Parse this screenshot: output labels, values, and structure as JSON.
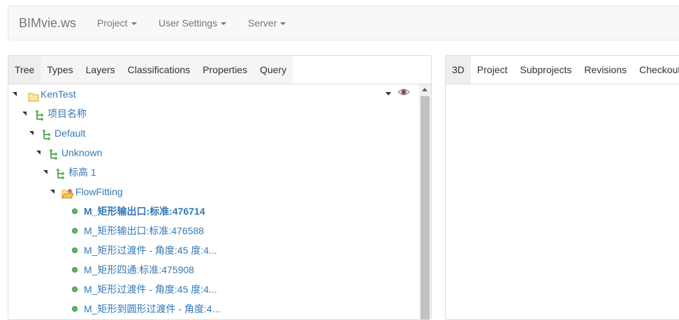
{
  "navbar": {
    "brand": "BIMvie.ws",
    "menus": [
      {
        "label": "Project"
      },
      {
        "label": "User Settings"
      },
      {
        "label": "Server"
      }
    ]
  },
  "left_panel": {
    "tabs": [
      {
        "label": "Tree",
        "active": true
      },
      {
        "label": "Types",
        "active": false
      },
      {
        "label": "Layers",
        "active": false
      },
      {
        "label": "Classifications",
        "active": false
      },
      {
        "label": "Properties",
        "active": false
      },
      {
        "label": "Query",
        "active": false
      }
    ],
    "tree": [
      {
        "label": "KenTest",
        "icon": "folder-icon",
        "level": 0
      },
      {
        "label": "项目名称",
        "icon": "hierarchy-icon",
        "level": 1
      },
      {
        "label": "Default",
        "icon": "hierarchy-icon",
        "level": 2
      },
      {
        "label": "Unknown",
        "icon": "hierarchy-icon",
        "level": 3
      },
      {
        "label": "标高 1",
        "icon": "hierarchy-icon",
        "level": 4
      },
      {
        "label": "FlowFitting",
        "icon": "folder-open-icon",
        "level": 5
      },
      {
        "label": "M_矩形输出口:标准:476714",
        "icon": "leaf-dot-icon",
        "level": 6,
        "bold": true
      },
      {
        "label": "M_矩形输出口:标准:476588",
        "icon": "leaf-dot-icon",
        "level": 6
      },
      {
        "label": "M_矩形过渡件 - 角度:45 度:4...",
        "icon": "leaf-dot-icon",
        "level": 6
      },
      {
        "label": "M_矩形四通:标准:475908",
        "icon": "leaf-dot-icon",
        "level": 6
      },
      {
        "label": "M_矩形过渡件 - 角度:45 度:4...",
        "icon": "leaf-dot-icon",
        "level": 6
      },
      {
        "label": "M_矩形到圆形过渡件 - 角度:4...",
        "icon": "leaf-dot-icon",
        "level": 6
      }
    ]
  },
  "right_panel": {
    "tabs": [
      {
        "label": "3D",
        "active": true
      },
      {
        "label": "Project",
        "active": false
      },
      {
        "label": "Subprojects",
        "active": false
      },
      {
        "label": "Revisions",
        "active": false
      },
      {
        "label": "Checkout",
        "active": false
      }
    ]
  },
  "colors": {
    "link": "#337ab7",
    "navbar_bg": "#f8f8f8",
    "leaf_dot": "#5cb85c",
    "active_tab_bg": "#eeeeee"
  }
}
